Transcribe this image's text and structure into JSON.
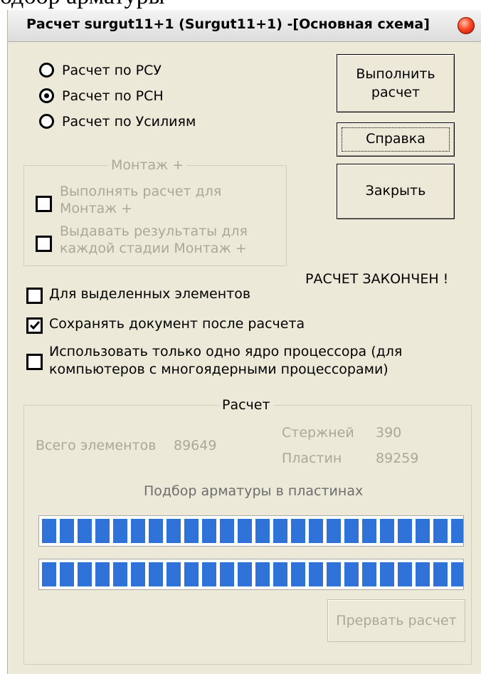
{
  "background_text": "одбор арматуры",
  "window": {
    "title": "Расчет surgut11+1 (Surgut11+1) -[Основная схема]",
    "close_icon": "red-ball-close-icon"
  },
  "mode_options": [
    {
      "label": "Расчет по РСУ",
      "selected": false
    },
    {
      "label": "Расчет по РСН",
      "selected": true
    },
    {
      "label": "Расчет по Усилиям",
      "selected": false
    }
  ],
  "buttons": {
    "run_line1": "Выполнить",
    "run_line2": "расчет",
    "help": "Справка",
    "close": "Закрыть",
    "abort": "Прервать расчет"
  },
  "montage": {
    "legend": "Монтаж +",
    "opt1_line1": "Выполнять расчет для",
    "opt1_line2": "Монтаж +",
    "opt2_line1": "Выдавать результаты для",
    "opt2_line2": "каждой стадии Монтаж +"
  },
  "status": "РАСЧЕТ ЗАКОНЧЕН !",
  "options": {
    "selected_only": {
      "label": "Для выделенных элементов",
      "checked": false
    },
    "save_doc": {
      "label": "Сохранять документ после расчета",
      "checked": true
    },
    "single_core_line1": "Использовать только одно ядро процессора (для",
    "single_core_line2": "компьютеров с многоядерными процессорами)",
    "single_core_checked": false
  },
  "calc": {
    "legend": "Расчет",
    "total_label": "Всего элементов",
    "total_value": "89649",
    "rods_label": "Стержней",
    "rods_value": "390",
    "plates_label": "Пластин",
    "plates_value": "89259",
    "stage": "Подбор арматуры в пластинах",
    "progress1": 1.0,
    "progress2": 1.0
  }
}
